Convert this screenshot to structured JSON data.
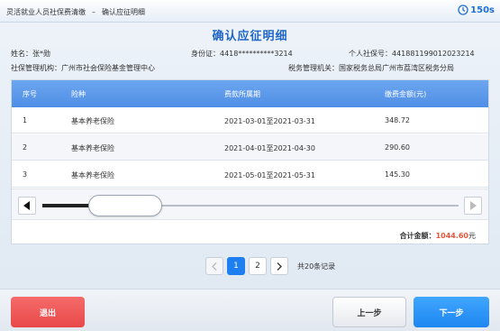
{
  "header": {
    "breadcrumb": [
      "灵活就业人员社保费清缴",
      "确认应征明细"
    ],
    "breadcrumb_separator": "–",
    "timer": "150s"
  },
  "page": {
    "title": "确认应征明细"
  },
  "info": {
    "name_label": "姓名：",
    "name_value": "张*勋",
    "id_label": "身份证：",
    "id_value": "4418**********3214",
    "social_no_label": "个人社保号：",
    "social_no_value": "441881199012023214",
    "agency_label": "社保管理机构：",
    "agency_value": "广州市社会保险基金管理中心",
    "tax_label": "税务管理机关：",
    "tax_value": "国家税务总局广州市荔湾区税务分局"
  },
  "table": {
    "headers": [
      "序号",
      "险种",
      "费款所属期",
      "缴费金额(元)"
    ],
    "rows": [
      [
        "1",
        "基本养老保险",
        "2021-03-01至2021-03-31",
        "348.72"
      ],
      [
        "2",
        "基本养老保险",
        "2021-04-01至2021-04-30",
        "290.60"
      ],
      [
        "3",
        "基本养老保险",
        "2021-05-01至2021-05-31",
        "145.30"
      ]
    ],
    "total_label": "合计金额：",
    "total_value": "1044.60",
    "total_unit": "元"
  },
  "pagination": {
    "pages": [
      "1",
      "2"
    ],
    "current": "1",
    "summary": "共20条记录"
  },
  "buttons": {
    "exit": "退出",
    "prev": "上一步",
    "next": "下一步"
  },
  "colors": {
    "accent": "#1e7ff0",
    "title": "#1f66c7",
    "danger": "#e94848",
    "total_amount": "#e8553a"
  }
}
